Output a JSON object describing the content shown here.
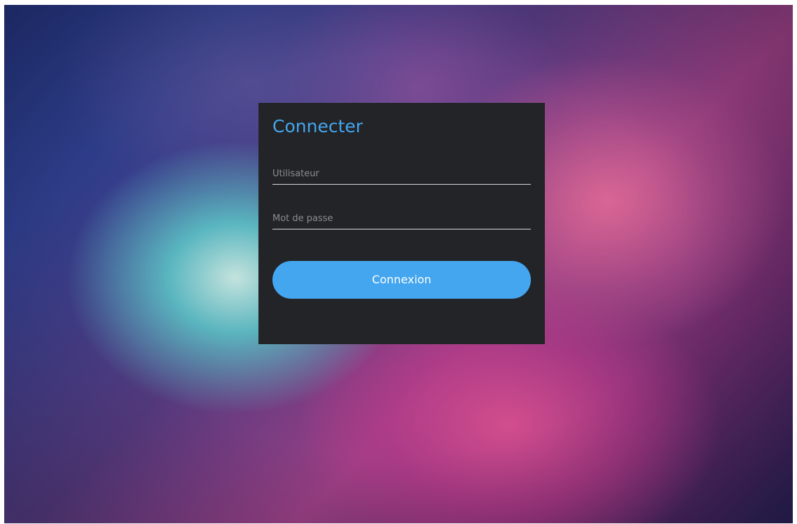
{
  "login": {
    "title": "Connecter",
    "username": {
      "value": "",
      "placeholder": "Utilisateur"
    },
    "password": {
      "value": "",
      "placeholder": "Mot de passe"
    },
    "submit_label": "Connexion"
  },
  "colors": {
    "accent": "#44a6ef",
    "panel": "#232427",
    "underline": "#d8d8d8",
    "placeholder": "#8a8d93"
  }
}
